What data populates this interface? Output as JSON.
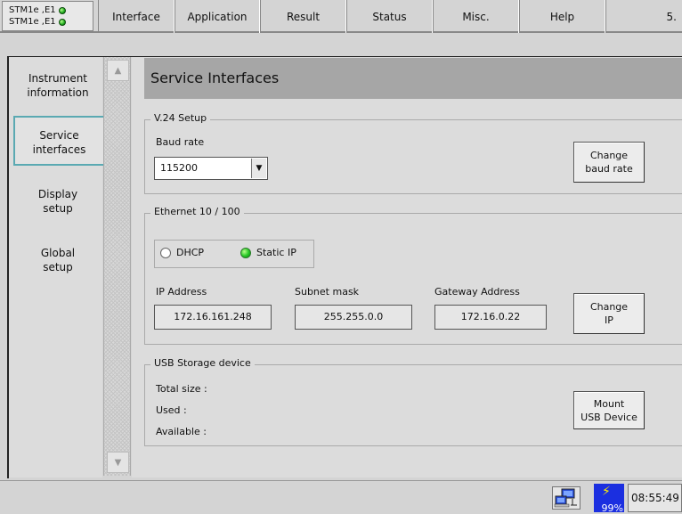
{
  "status": {
    "line1": "STM1e ,E1",
    "line2": "STM1e ,E1"
  },
  "menu": {
    "items": [
      "Interface",
      "Application",
      "Result",
      "Status",
      "Misc.",
      "Help"
    ],
    "version": "5."
  },
  "sidebar": {
    "items": [
      {
        "line1": "Instrument",
        "line2": "information"
      },
      {
        "line1": "Service",
        "line2": "interfaces"
      },
      {
        "line1": "Display",
        "line2": "setup"
      },
      {
        "line1": "Global",
        "line2": "setup"
      }
    ],
    "active_index": 1
  },
  "page": {
    "title": "Service Interfaces"
  },
  "v24": {
    "legend": "V.24 Setup",
    "baud_label": "Baud rate",
    "baud_value": "115200",
    "change_line1": "Change",
    "change_line2": "baud rate"
  },
  "ethernet": {
    "legend": "Ethernet 10 / 100",
    "dhcp_label": "DHCP",
    "static_label": "Static IP",
    "selected": "Static IP",
    "ip_label": "IP Address",
    "ip_value": "172.16.161.248",
    "subnet_label": "Subnet mask",
    "subnet_value": "255.255.0.0",
    "gateway_label": "Gateway Address",
    "gateway_value": "172.16.0.22",
    "change_line1": "Change",
    "change_line2": "IP"
  },
  "usb": {
    "legend": "USB Storage device",
    "total_label": "Total size :",
    "used_label": "Used :",
    "available_label": "Available :",
    "mount_line1": "Mount",
    "mount_line2": "USB Device"
  },
  "footer": {
    "battery_percent": "99%",
    "time": "08:55:49"
  }
}
